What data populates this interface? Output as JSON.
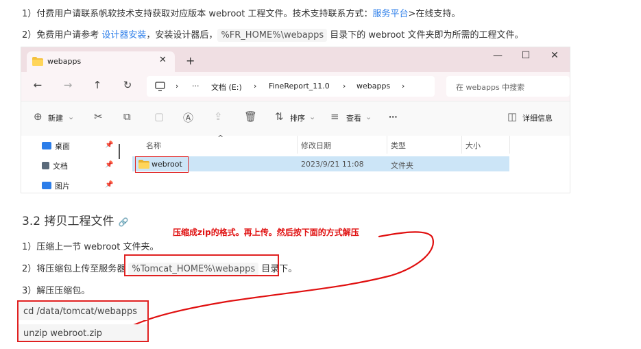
{
  "intro": {
    "line1_text": "1）付费用户请联系帆软技术支持获取对应版本 webroot 工程文件。技术支持联系方式：",
    "line1_link": "服务平台",
    "line1_tail": ">在线支持。",
    "line2_pre": "2）免费用户请参考 ",
    "line2_link": "设计器安装",
    "line2_mid": "，安装设计器后，",
    "line2_code": "%FR_HOME%\\webapps",
    "line2_tail": " 目录下的 webroot 文件夹即为所需的工程文件。"
  },
  "explorer": {
    "tab_title": "webapps",
    "tab_close": "✕",
    "tab_add": "+",
    "window_controls": {
      "minimize": "—",
      "maximize": "☐",
      "close": "✕"
    },
    "nav": {
      "back": "←",
      "forward": "→",
      "up": "↑",
      "refresh": "↻"
    },
    "breadcrumb": [
      "文档 (E:)",
      "FineReport_11.0",
      "webapps"
    ],
    "breadcrumb_more": "···",
    "search_placeholder": "在 webapps 中搜索",
    "toolbar": {
      "new_label": "新建",
      "sort_label": "排序",
      "view_label": "查看",
      "more_label": "···",
      "details_label": "详细信息"
    },
    "quick_access": [
      {
        "label": "桌面",
        "icon": "desktop-icon",
        "color": "#2b7de9"
      },
      {
        "label": "文档",
        "icon": "document-icon",
        "color": "#5a6a7a"
      },
      {
        "label": "图片",
        "icon": "picture-icon",
        "color": "#2b7de9"
      }
    ],
    "columns": {
      "name": "名称",
      "modified": "修改日期",
      "type": "类型",
      "size": "大小"
    },
    "files": [
      {
        "name": "webroot",
        "modified": "2023/9/21 11:08",
        "type": "文件夹",
        "size": ""
      }
    ]
  },
  "section": {
    "heading": "3.2 拷贝工程文件",
    "anchor": "🔗",
    "annotation": "压缩成zip的格式。再上传。然后按下面的方式解压",
    "step1": "1）压缩上一节 webroot 文件夹。",
    "step2_pre": "2）将压缩包上传至服务器 ",
    "step2_code": "%Tomcat_HOME%\\webapps",
    "step2_tail": " 目录下。",
    "step3": "3）解压压缩包。",
    "code_lines": [
      "cd /data/tomcat/webapps",
      "unzip webroot.zip"
    ]
  },
  "colors": {
    "link": "#2b7de9",
    "annotation_red": "#e01010",
    "selection": "#cce5f7"
  }
}
